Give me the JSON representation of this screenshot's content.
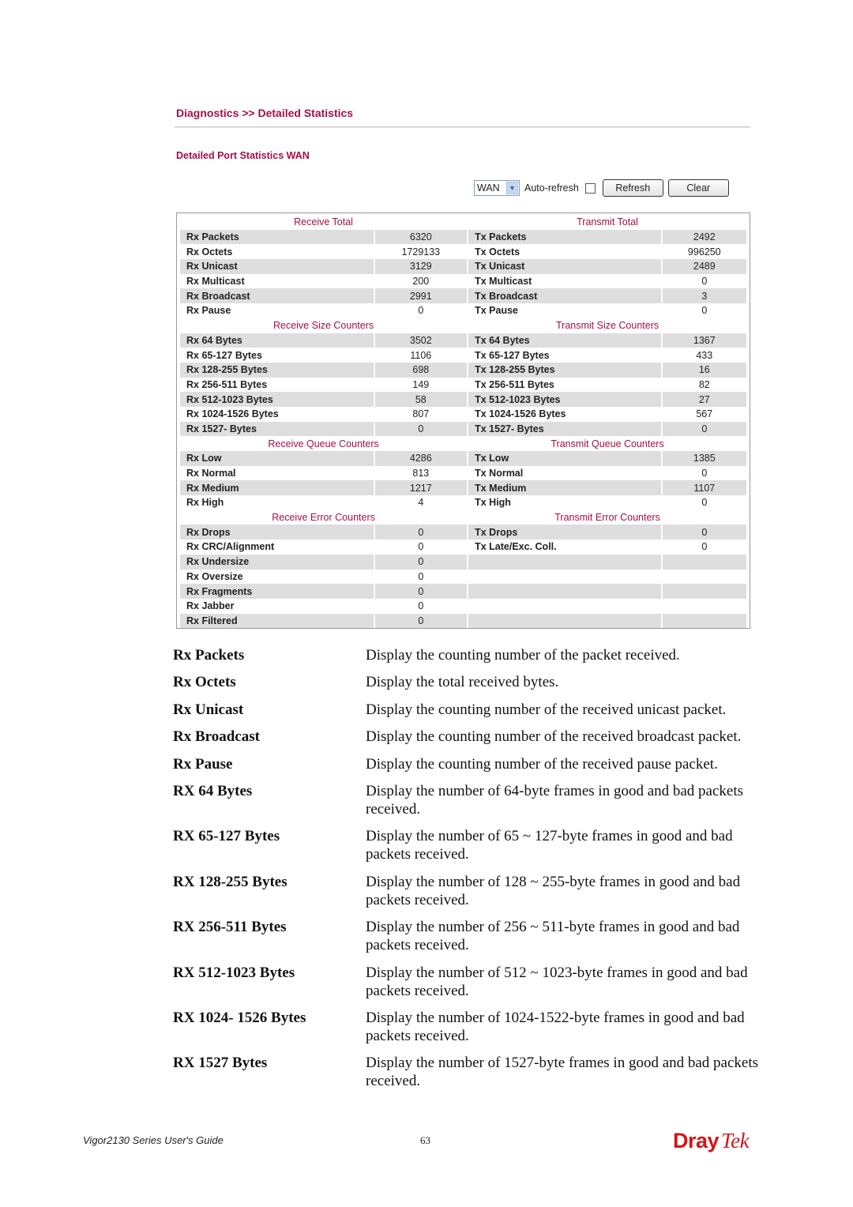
{
  "header": {
    "breadcrumb": "Diagnostics >> Detailed Statistics",
    "section_title": "Detailed Port Statistics  WAN"
  },
  "toolbar": {
    "port_select_value": "WAN",
    "autorefresh_label": "Auto-refresh",
    "autorefresh_checked": false,
    "refresh_label": "Refresh",
    "clear_label": "Clear"
  },
  "stats": {
    "groups": [
      {
        "rx_title": "Receive Total",
        "tx_title": "Transmit Total",
        "rows": [
          {
            "rx_label": "Rx Packets",
            "rx_value": "6320",
            "tx_label": "Tx Packets",
            "tx_value": "2492"
          },
          {
            "rx_label": "Rx Octets",
            "rx_value": "1729133",
            "tx_label": "Tx Octets",
            "tx_value": "996250"
          },
          {
            "rx_label": "Rx Unicast",
            "rx_value": "3129",
            "tx_label": "Tx Unicast",
            "tx_value": "2489"
          },
          {
            "rx_label": "Rx Multicast",
            "rx_value": "200",
            "tx_label": "Tx Multicast",
            "tx_value": "0"
          },
          {
            "rx_label": "Rx Broadcast",
            "rx_value": "2991",
            "tx_label": "Tx Broadcast",
            "tx_value": "3"
          },
          {
            "rx_label": "Rx Pause",
            "rx_value": "0",
            "tx_label": "Tx Pause",
            "tx_value": "0"
          }
        ]
      },
      {
        "rx_title": "Receive Size Counters",
        "tx_title": "Transmit Size Counters",
        "rows": [
          {
            "rx_label": "Rx 64 Bytes",
            "rx_value": "3502",
            "tx_label": "Tx 64 Bytes",
            "tx_value": "1367"
          },
          {
            "rx_label": "Rx 65-127 Bytes",
            "rx_value": "1106",
            "tx_label": "Tx 65-127 Bytes",
            "tx_value": "433"
          },
          {
            "rx_label": "Rx 128-255 Bytes",
            "rx_value": "698",
            "tx_label": "Tx 128-255 Bytes",
            "tx_value": "16"
          },
          {
            "rx_label": "Rx 256-511 Bytes",
            "rx_value": "149",
            "tx_label": "Tx 256-511 Bytes",
            "tx_value": "82"
          },
          {
            "rx_label": "Rx 512-1023 Bytes",
            "rx_value": "58",
            "tx_label": "Tx 512-1023 Bytes",
            "tx_value": "27"
          },
          {
            "rx_label": "Rx 1024-1526 Bytes",
            "rx_value": "807",
            "tx_label": "Tx 1024-1526 Bytes",
            "tx_value": "567"
          },
          {
            "rx_label": "Rx 1527- Bytes",
            "rx_value": "0",
            "tx_label": "Tx 1527- Bytes",
            "tx_value": "0"
          }
        ]
      },
      {
        "rx_title": "Receive Queue Counters",
        "tx_title": "Transmit Queue Counters",
        "rows": [
          {
            "rx_label": "Rx Low",
            "rx_value": "4286",
            "tx_label": "Tx Low",
            "tx_value": "1385"
          },
          {
            "rx_label": "Rx Normal",
            "rx_value": "813",
            "tx_label": "Tx Normal",
            "tx_value": "0"
          },
          {
            "rx_label": "Rx Medium",
            "rx_value": "1217",
            "tx_label": "Tx Medium",
            "tx_value": "1107"
          },
          {
            "rx_label": "Rx High",
            "rx_value": "4",
            "tx_label": "Tx High",
            "tx_value": "0"
          }
        ]
      },
      {
        "rx_title": "Receive Error Counters",
        "tx_title": "Transmit Error Counters",
        "rows": [
          {
            "rx_label": "Rx Drops",
            "rx_value": "0",
            "tx_label": "Tx Drops",
            "tx_value": "0"
          },
          {
            "rx_label": "Rx CRC/Alignment",
            "rx_value": "0",
            "tx_label": "Tx Late/Exc. Coll.",
            "tx_value": "0"
          },
          {
            "rx_label": "Rx Undersize",
            "rx_value": "0",
            "tx_label": "",
            "tx_value": ""
          },
          {
            "rx_label": "Rx Oversize",
            "rx_value": "0",
            "tx_label": "",
            "tx_value": ""
          },
          {
            "rx_label": "Rx Fragments",
            "rx_value": "0",
            "tx_label": "",
            "tx_value": ""
          },
          {
            "rx_label": "Rx Jabber",
            "rx_value": "0",
            "tx_label": "",
            "tx_value": ""
          },
          {
            "rx_label": "Rx Filtered",
            "rx_value": "0",
            "tx_label": "",
            "tx_value": ""
          }
        ]
      }
    ]
  },
  "descriptions": [
    {
      "term": "Rx Packets",
      "definition": "Display the counting number of the packet received."
    },
    {
      "term": "Rx Octets",
      "definition": "Display the total received bytes."
    },
    {
      "term": "Rx Unicast",
      "definition": "Display the counting number of the received unicast packet."
    },
    {
      "term": "Rx Broadcast",
      "definition": "Display the counting number of the received broadcast packet."
    },
    {
      "term": "Rx Pause",
      "definition": "Display the counting number of the received pause packet."
    },
    {
      "term": "RX 64 Bytes",
      "definition": "Display the number of 64-byte frames in good and bad packets received."
    },
    {
      "term": "RX 65-127 Bytes",
      "definition": "Display the number of 65 ~ 127-byte frames in good and bad packets received."
    },
    {
      "term": "RX 128-255 Bytes",
      "definition": "Display the number of 128 ~ 255-byte frames in good and bad packets received."
    },
    {
      "term": "RX 256-511 Bytes",
      "definition": "Display the number of 256 ~ 511-byte frames in good and bad packets received."
    },
    {
      "term": "RX 512-1023 Bytes",
      "definition": "Display the number of 512 ~ 1023-byte frames in good and bad packets received."
    },
    {
      "term": "RX 1024- 1526 Bytes",
      "definition": "Display the number of 1024-1522-byte frames in good and bad packets received."
    },
    {
      "term": "RX 1527 Bytes",
      "definition": "Display the number of 1527-byte frames in good and bad packets received."
    }
  ],
  "footer": {
    "guide_title": "Vigor2130 Series User's Guide",
    "page_number": "63",
    "logo_part1": "Dray",
    "logo_part2": "Tek"
  },
  "colors": {
    "accent": "#a3104a",
    "row_shade": "#dedede",
    "logo": "#d0161b"
  }
}
